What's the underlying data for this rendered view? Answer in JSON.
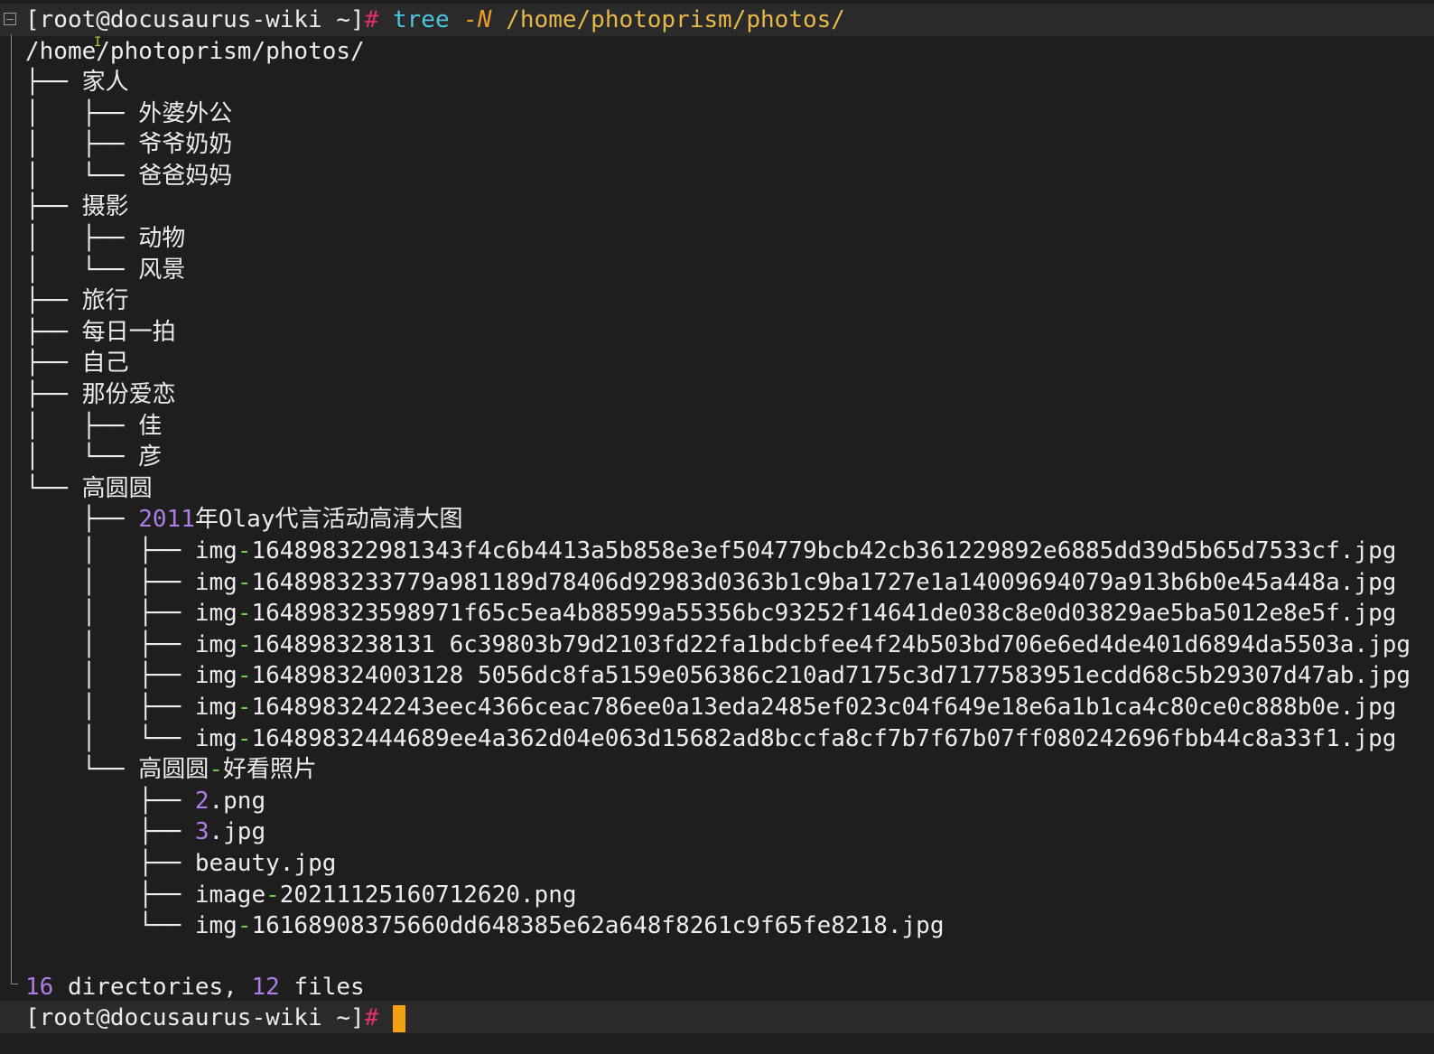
{
  "prompt": {
    "host": "[root@docusaurus-wiki ~]",
    "symbol": "#",
    "command": "tree",
    "flag": "-N",
    "argument": "/home/photoprism/photos/"
  },
  "tree": {
    "root": "/home/photoprism/photos/",
    "entries": [
      {
        "prefix": "├── ",
        "name": "家人"
      },
      {
        "prefix": "│   ├── ",
        "name": "外婆外公"
      },
      {
        "prefix": "│   ├── ",
        "name": "爷爷奶奶"
      },
      {
        "prefix": "│   └── ",
        "name": "爸爸妈妈"
      },
      {
        "prefix": "├── ",
        "name": "摄影"
      },
      {
        "prefix": "│   ├── ",
        "name": "动物"
      },
      {
        "prefix": "│   └── ",
        "name": "风景"
      },
      {
        "prefix": "├── ",
        "name": "旅行"
      },
      {
        "prefix": "├── ",
        "name": "每日一拍"
      },
      {
        "prefix": "├── ",
        "name": "自己"
      },
      {
        "prefix": "├── ",
        "name": "那份爱恋"
      },
      {
        "prefix": "│   ├── ",
        "name": "佳"
      },
      {
        "prefix": "│   └── ",
        "name": "彦"
      },
      {
        "prefix": "└── ",
        "name": "高圆圆"
      },
      {
        "prefix": "    ├── ",
        "num": "2011",
        "name": "年Olay代言活动高清大图"
      },
      {
        "prefix": "    │   ├── ",
        "stem": "img",
        "sep": "-",
        "name": "164898322981343f4c6b4413a5b858e3ef504779bcb42cb361229892e6885dd39d5b65d7533cf.jpg"
      },
      {
        "prefix": "    │   ├── ",
        "stem": "img",
        "sep": "-",
        "name": "1648983233779a981189d78406d92983d0363b1c9ba1727e1a14009694079a913b6b0e45a448a.jpg"
      },
      {
        "prefix": "    │   ├── ",
        "stem": "img",
        "sep": "-",
        "name": "164898323598971f65c5ea4b88599a55356bc93252f14641de038c8e0d03829ae5ba5012e8e5f.jpg"
      },
      {
        "prefix": "    │   ├── ",
        "stem": "img",
        "sep": "-",
        "name": "1648983238131 6c39803b79d2103fd22fa1bdcbfee4f24b503bd706e6ed4de401d6894da5503a.jpg"
      },
      {
        "prefix": "    │   ├── ",
        "stem": "img",
        "sep": "-",
        "name": "164898324003128 5056dc8fa5159e056386c210ad7175c3d7177583951ecdd68c5b29307d47ab.jpg"
      },
      {
        "prefix": "    │   ├── ",
        "stem": "img",
        "sep": "-",
        "name": "1648983242243eec4366ceac786ee0a13eda2485ef023c04f649e18e6a1b1ca4c80ce0c888b0e.jpg"
      },
      {
        "prefix": "    │   └── ",
        "stem": "img",
        "sep": "-",
        "name": "16489832444689ee4a362d04e063d15682ad8bccfa8cf7b7f67b07ff080242696fbb44c8a33f1.jpg"
      },
      {
        "prefix": "    └── ",
        "stem": "高圆圆",
        "sep": "-",
        "name": "好看照片"
      },
      {
        "prefix": "        ├── ",
        "num": "2",
        "name": ".png"
      },
      {
        "prefix": "        ├── ",
        "num": "3",
        "name": ".jpg"
      },
      {
        "prefix": "        ├── ",
        "name": "beauty.jpg"
      },
      {
        "prefix": "        ├── ",
        "stem": "image",
        "sep": "-",
        "name": "20211125160712620.png"
      },
      {
        "prefix": "        └── ",
        "stem": "img",
        "sep": "-",
        "name": "16168908375660dd648385e62a648f8261c9f65fe8218.jpg"
      }
    ]
  },
  "summary": {
    "dirs_count": "16",
    "dirs_label": " directories, ",
    "files_count": "12",
    "files_label": " files"
  },
  "colors": {
    "background": "#1e1e1e",
    "prompt_hash": "#e0306a",
    "command": "#4fc3e0",
    "flag": "#e89a2a",
    "path": "#e8b84a",
    "number": "#b07de6",
    "dash": "#6ad04a",
    "cursor": "#f0a010"
  }
}
